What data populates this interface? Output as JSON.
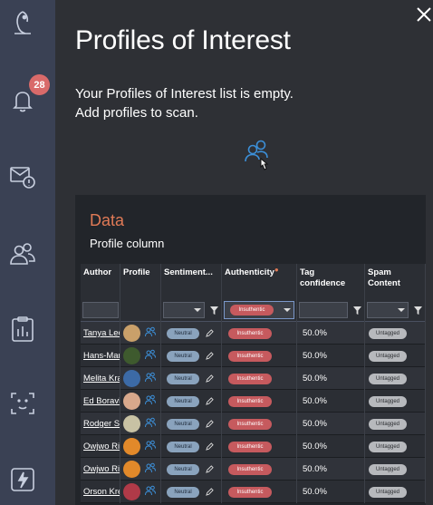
{
  "sidebar": {
    "notification_count": "28",
    "items": [
      {
        "name": "logo",
        "icon": "owl-logo-icon"
      },
      {
        "name": "notifications",
        "icon": "bell-icon"
      },
      {
        "name": "messages",
        "icon": "mail-alert-icon"
      },
      {
        "name": "profiles",
        "icon": "users-icon"
      },
      {
        "name": "reports",
        "icon": "clipboard-chart-icon"
      },
      {
        "name": "face-scan",
        "icon": "face-scan-icon"
      },
      {
        "name": "flash",
        "icon": "lightning-icon"
      }
    ]
  },
  "panel": {
    "title": "Profiles of Interest",
    "empty_message_line1": "Your Profiles of Interest list is empty.",
    "empty_message_line2": "Add profiles to scan.",
    "add_icon": "add-users-icon"
  },
  "card": {
    "title": "Data",
    "subtitle": "Profile column",
    "columns": {
      "author": "Author",
      "profile": "Profile",
      "sentiment": "Sentiment...",
      "authenticity": "Authenticity",
      "tag_confidence_1": "Tag",
      "tag_confidence_2": "confidence",
      "spam_1": "Spam",
      "spam_2": "Content"
    },
    "filter_authenticity": "Insuthentic",
    "rows": [
      {
        "author": "Tanya Leon",
        "sentiment": "Neutral",
        "authenticity": "Insuthentic",
        "tag_conf": "50.0%",
        "spam": "Untagged",
        "avatar": "#c9a06a"
      },
      {
        "author": "Hans-Mart",
        "sentiment": "Neutral",
        "authenticity": "Insuthentic",
        "tag_conf": "50.0%",
        "spam": "Untagged",
        "avatar": "#3e5a2e"
      },
      {
        "author": "Melita Kra",
        "sentiment": "Neutral",
        "authenticity": "Insuthentic",
        "tag_conf": "50.0%",
        "spam": "Untagged",
        "avatar": "#3c6aa6"
      },
      {
        "author": "Ed Boravik",
        "sentiment": "Neutral",
        "authenticity": "Insuthentic",
        "tag_conf": "50.0%",
        "spam": "Untagged",
        "avatar": "#d8a88c"
      },
      {
        "author": "Rodger Sra",
        "sentiment": "Neutral",
        "authenticity": "Insuthentic",
        "tag_conf": "50.0%",
        "spam": "Untagged",
        "avatar": "#c8c2a4"
      },
      {
        "author": "Owjwo Rir",
        "sentiment": "Neutral",
        "authenticity": "Insuthentic",
        "tag_conf": "50.0%",
        "spam": "Untagged",
        "avatar": "#e2892a"
      },
      {
        "author": "Owjwo Rir",
        "sentiment": "Neutral",
        "authenticity": "Insuthentic",
        "tag_conf": "50.0%",
        "spam": "Untagged",
        "avatar": "#e2892a"
      },
      {
        "author": "Orson Kre",
        "sentiment": "Neutral",
        "authenticity": "Insuthentic",
        "tag_conf": "50.0%",
        "spam": "Untagged",
        "avatar": "#b03a48"
      }
    ]
  },
  "colors": {
    "sidebar_bg": "#3a4154",
    "panel_bg": "#2e3035",
    "card_bg": "#22252a",
    "accent_orange": "#e07a56",
    "badge_red": "#d96a6a",
    "link_blue": "#3c8fd8"
  }
}
